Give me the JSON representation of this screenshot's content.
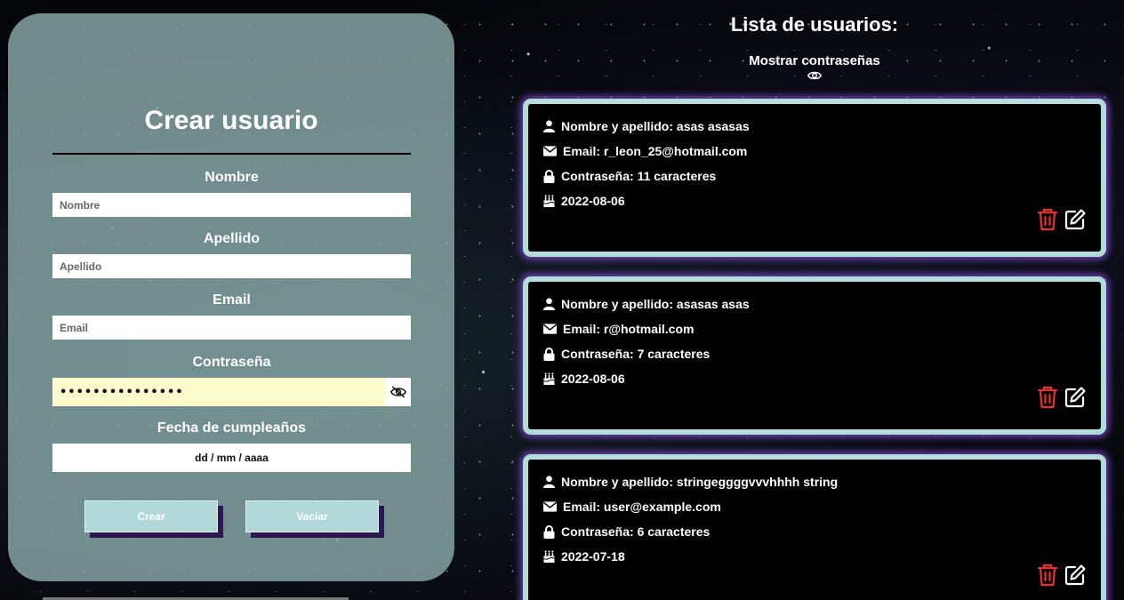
{
  "form": {
    "title": "Crear usuario",
    "fields": {
      "nombre": {
        "label": "Nombre",
        "placeholder": "Nombre",
        "value": ""
      },
      "apellido": {
        "label": "Apellido",
        "placeholder": "Apellido",
        "value": ""
      },
      "email": {
        "label": "Email",
        "placeholder": "Email",
        "value": ""
      },
      "password": {
        "label": "Contraseña",
        "value": "•••••••••••••••"
      },
      "birthday": {
        "label": "Fecha de cumpleaños",
        "placeholder": "dd / mm / aaaa"
      }
    },
    "buttons": {
      "create": "Crear",
      "clear": "Vaciar"
    }
  },
  "list": {
    "title": "Lista de usuarios:",
    "show_passwords": "Mostrar contraseñas",
    "users": [
      {
        "name": "Nombre y apellido: asas asasas",
        "email": "Email: r_leon_25@hotmail.com",
        "password": "Contraseña: 11 caracteres",
        "birthday": "2022-08-06"
      },
      {
        "name": "Nombre y apellido: asasas asas",
        "email": "Email: r@hotmail.com",
        "password": "Contraseña: 7 caracteres",
        "birthday": "2022-08-06"
      },
      {
        "name": "Nombre y apellido: stringeggggvvvhhhh string",
        "email": "Email: user@example.com",
        "password": "Contraseña: 6 caracteres",
        "birthday": "2022-07-18"
      }
    ]
  },
  "colors": {
    "card_border": "#b2dcd9",
    "card_glow": "#7a46c8",
    "delete_icon": "#e8312f",
    "edit_icon": "#ffffff",
    "button_bg": "#b0d8d8",
    "button_shadow": "#2b1752",
    "password_field_bg": "#fdfccc",
    "panel_bg": "#84a2a2"
  },
  "icons": [
    "user-icon",
    "envelope-icon",
    "lock-icon",
    "cake-icon",
    "trash-icon",
    "edit-icon",
    "eye-icon",
    "eye-slash-icon"
  ]
}
